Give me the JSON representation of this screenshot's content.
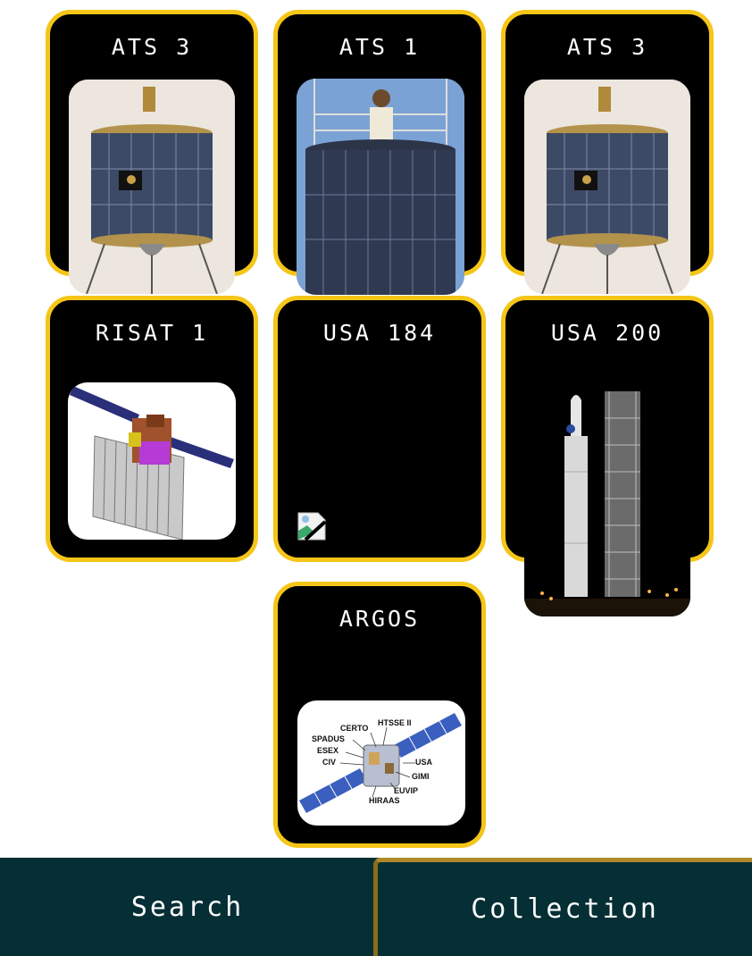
{
  "cards": [
    {
      "title": "ATS 3",
      "image": "satellite-photo"
    },
    {
      "title": "ATS 1",
      "image": "satellite-with-person-photo"
    },
    {
      "title": "ATS 3",
      "image": "satellite-photo"
    },
    {
      "title": "RISAT 1",
      "image": "satellite-diagram"
    },
    {
      "title": "USA 184",
      "image": "broken-image-icon"
    },
    {
      "title": "USA 200",
      "image": "rocket-launch-photo"
    },
    {
      "title": "ARGOS",
      "image": "labeled-satellite-diagram"
    }
  ],
  "argos_labels": [
    "CERTO",
    "HTSSE II",
    "SPADUS",
    "ESEX",
    "CIV",
    "USA",
    "GIMI",
    "EUVIP",
    "HIRAAS"
  ],
  "nav": {
    "search_label": "Search",
    "collection_label": "Collection",
    "active_tab": "Collection"
  },
  "colors": {
    "card_border": "#f5c518",
    "card_bg": "#000000",
    "nav_bg": "#062f35"
  }
}
